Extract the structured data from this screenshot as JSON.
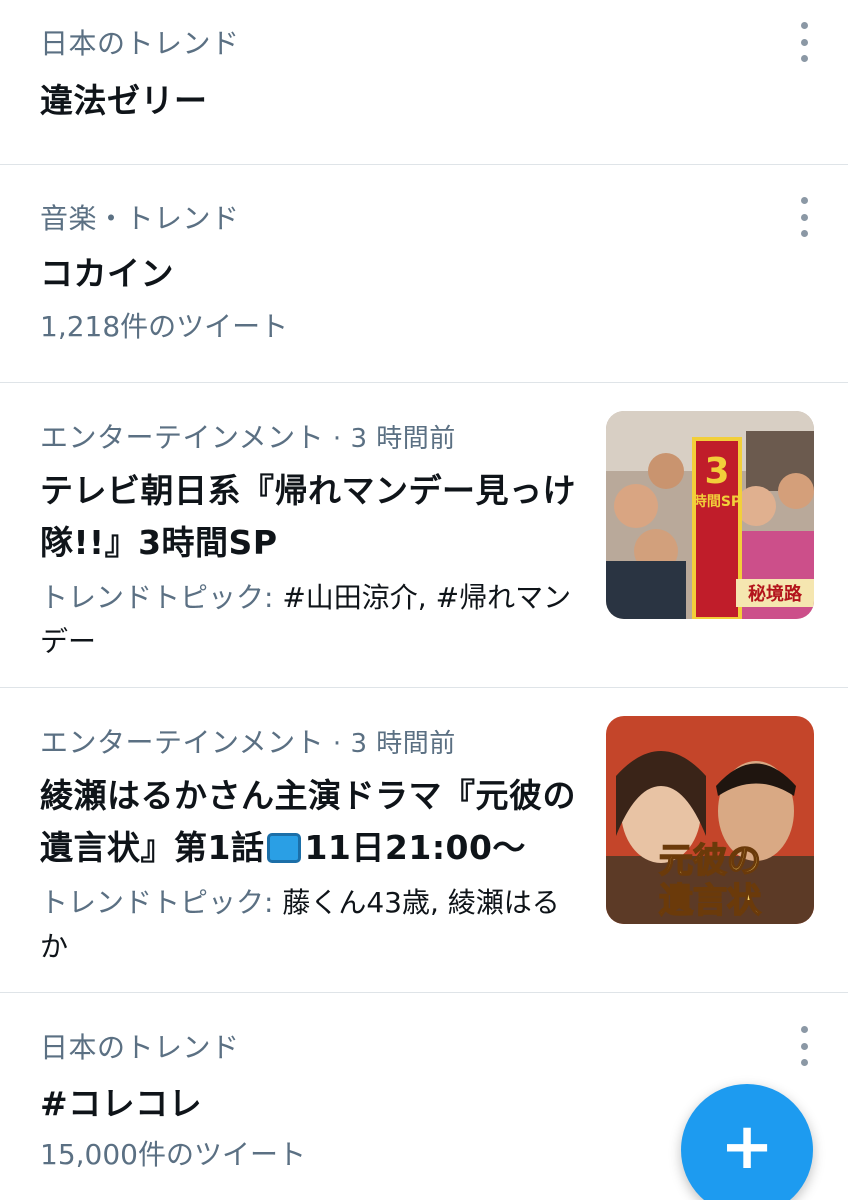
{
  "trends": [
    {
      "meta": "日本のトレンド",
      "title": "違法ゼリー"
    },
    {
      "meta": "音楽・トレンド",
      "title": "コカイン",
      "count": "1,218件のツイート"
    },
    {
      "meta_category": "エンターテインメント",
      "meta_time": " · 3 時間前",
      "title": "テレビ朝日系『帰れマンデー見っけ隊!!』3時間SP",
      "topics_label": "トレンドトピック: ",
      "topics_value": "#山田涼介, #帰れマンデー",
      "thumb_text_1": "3",
      "thumb_text_2": "時間SP",
      "thumb_text_3": "秘境路"
    },
    {
      "meta_category": "エンターテインメント",
      "meta_time": " · 3 時間前",
      "title_a": "綾瀬はるかさん主演ドラマ『元彼の遺言状』第1話",
      "title_b": "11日21:00〜",
      "topics_label": "トレンドトピック: ",
      "topics_value": "藤くん43歳, 綾瀬はるか",
      "thumb_text_1": "元彼の",
      "thumb_text_2": "遺言状"
    },
    {
      "meta": "日本のトレンド",
      "title": "#コレコレ",
      "count": "15,000件のツイート"
    }
  ],
  "fab": {
    "label": "+"
  },
  "colors": {
    "accent": "#1d9bf0",
    "secondary_text": "#5b7083",
    "primary_text": "#0f1419"
  },
  "icons": {
    "more": "more-vertical-icon",
    "tv": "tv-icon",
    "compose": "plus-icon"
  }
}
